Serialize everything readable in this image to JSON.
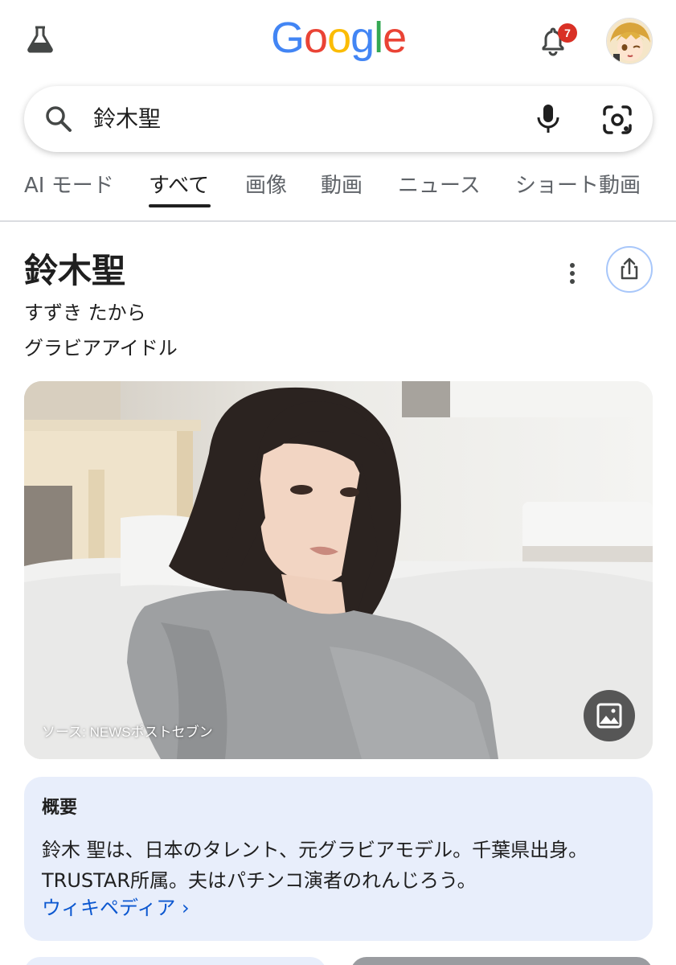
{
  "header": {
    "logo_letters": [
      "G",
      "o",
      "o",
      "g",
      "l",
      "e"
    ],
    "logo_colors": [
      "#4285F4",
      "#EA4335",
      "#FBBC05",
      "#4285F4",
      "#34A853",
      "#EA4335"
    ],
    "notification_count": "7",
    "icons": {
      "labs": "flask-icon",
      "notifications": "bell-icon",
      "avatar": "avatar"
    }
  },
  "search": {
    "query": "鈴木聖",
    "icons": {
      "search": "search-icon",
      "voice": "mic-icon",
      "lens": "lens-icon"
    }
  },
  "tabs": [
    {
      "label": "AI モード",
      "active": false
    },
    {
      "label": "すべて",
      "active": true
    },
    {
      "label": "画像",
      "active": false
    },
    {
      "label": "動画",
      "active": false
    },
    {
      "label": "ニュース",
      "active": false
    },
    {
      "label": "ショート動画",
      "active": false
    }
  ],
  "knowledge_panel": {
    "title": "鈴木聖",
    "reading": "すずき たから",
    "description": "グラビアアイドル",
    "image_source": "ソース: NEWSポストセブン",
    "overview": {
      "heading": "概要",
      "text": "鈴木 聖は、日本のタレント、元グラビアモデル。千葉県出身。TRUSTAR所属。夫はパチンコ演者のれんじろう。",
      "link": "ウィキペディア ›"
    }
  },
  "colors": {
    "accent_link": "#0b57d0",
    "badge": "#d93025",
    "overview_bg": "#e8eefb",
    "share_border": "#a8c7fa"
  }
}
